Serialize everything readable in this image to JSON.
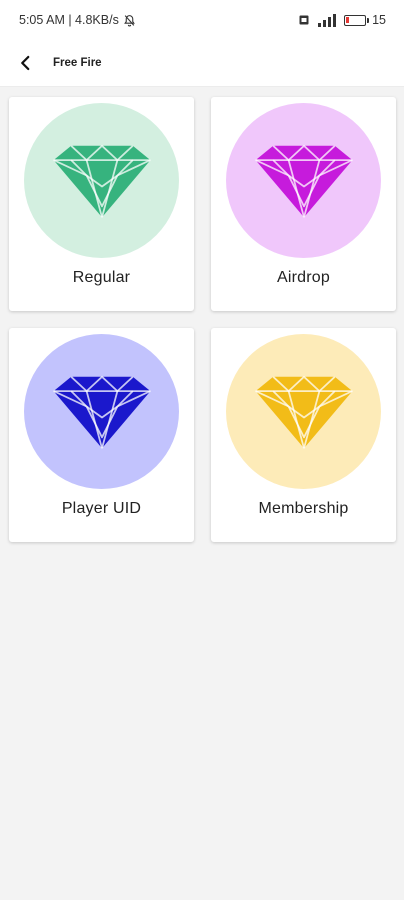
{
  "status_bar": {
    "time_speed": "5:05 AM | 4.8KB/s",
    "battery_percent_label": "15",
    "battery_level": 0.15,
    "icons": [
      "alarm-off-icon",
      "sim-card-icon",
      "signal-icon",
      "battery-icon"
    ]
  },
  "header": {
    "title": "Free Fire",
    "back_icon": "back-arrow-icon"
  },
  "categories": [
    {
      "label": "Regular",
      "circle_color": "#d3efe0",
      "diamond_color": "#36b37e"
    },
    {
      "label": "Airdrop",
      "circle_color": "#f0c7fb",
      "diamond_color": "#c61bdc"
    },
    {
      "label": "Player UID",
      "circle_color": "#c2c3fd",
      "diamond_color": "#1b18cc"
    },
    {
      "label": "Membership",
      "circle_color": "#fdebb8",
      "diamond_color": "#f2bc18"
    }
  ]
}
